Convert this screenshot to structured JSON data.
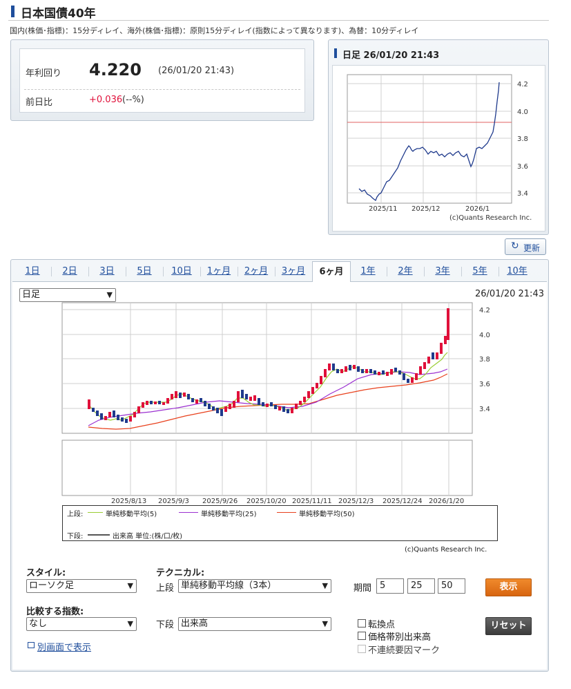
{
  "page": {
    "title": "日本国債40年",
    "notice": "国内(株価･指標)：15分ディレイ、海外(株価･指標)：原則15分ディレイ(指数によって異なります)、為替：10分ディレイ"
  },
  "quote": {
    "yield_label": "年利回り",
    "yield_value": "4.220",
    "time": "(26/01/20 21:43)",
    "change_label": "前日比",
    "change_value": "+0.036",
    "change_pct": "(--%)"
  },
  "mini_chart": {
    "header": "日足 26/01/20 21:43",
    "y_ticks": [
      "4.2",
      "4.0",
      "3.8",
      "3.6",
      "3.4"
    ],
    "x_ticks": [
      "2025/11",
      "2025/12",
      "2026/1"
    ],
    "copyright": "(c)Quants Research Inc."
  },
  "refresh_label": "更新",
  "tabs": [
    "1日",
    "2日",
    "3日",
    "5日",
    "10日",
    "1ヶ月",
    "2ヶ月",
    "3ヶ月",
    "6ヶ月",
    "1年",
    "2年",
    "3年",
    "5年",
    "10年"
  ],
  "selected_tab": "6ヶ月",
  "main_chart": {
    "period_select": "日足",
    "timestamp": "26/01/20 21:43",
    "y_ticks": [
      "4.2",
      "4.0",
      "3.8",
      "3.6",
      "3.4"
    ],
    "x_ticks": [
      "2025/8/13",
      "2025/9/3",
      "2025/9/26",
      "2025/10/20",
      "2025/11/11",
      "2025/12/3",
      "2025/12/24",
      "2026/1/20"
    ],
    "legend": {
      "upper_label": "上段:",
      "ma5": "単純移動平均(5)",
      "ma25": "単純移動平均(25)",
      "ma50": "単純移動平均(50)",
      "lower_label": "下段:",
      "volume": "出来高 単位:(株/口/枚)"
    },
    "colors": {
      "ma5": "#9acd32",
      "ma25": "#9b30d0",
      "ma50": "#e8401c",
      "up": "#e0103a",
      "down": "#1f3a8c"
    },
    "copyright": "(c)Quants Research Inc."
  },
  "controls": {
    "style_label": "スタイル:",
    "style_value": "ローソク足",
    "technical_label": "テクニカル:",
    "upper_label": "上段",
    "upper_value": "単純移動平均線（3本）",
    "period_label": "期間",
    "periods": [
      "5",
      "25",
      "50"
    ],
    "show_button": "表示",
    "compare_label": "比較する指数:",
    "compare_value": "なし",
    "lower_label": "下段",
    "lower_value": "出来高",
    "options": [
      "転換点",
      "価格帯別出来高",
      "不連続要因マーク"
    ],
    "reset_button": "リセット",
    "popup_link": "別画面で表示"
  }
}
